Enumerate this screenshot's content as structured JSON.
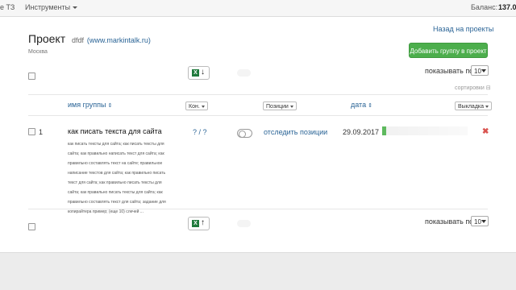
{
  "topbar": {
    "nav_tz": "е ТЗ",
    "nav_tools": "Инструменты",
    "balance_label": "Баланс:",
    "balance_value": "137.0"
  },
  "project": {
    "title": "Проект",
    "subtitle": "dfdf",
    "site": "(www.markintalk.ru)",
    "city": "Москва"
  },
  "actions": {
    "back": "Назад на проекты",
    "add_group": "Добавить группу в проект"
  },
  "pagination": {
    "show_label": "показывать по",
    "per_page": "10"
  },
  "sort_label": "сортировки",
  "columns": {
    "group_name": "имя группы",
    "competitors": "Кон.",
    "positions": "Позиции",
    "date": "дата",
    "unload": "Выкладка"
  },
  "rows": [
    {
      "num": "1",
      "name": "как писать текста для сайта",
      "keywords": "как писать тексты для сайта; как писать тексты для сайта; как правильно написать текст для сайта; как правильно составлять текст на сайте; правильное написание текстов для сайта; как правильно писать текст для сайта; как правильно писать тексты для сайта; как правильно писать тексты для сайта; как правильно составлять текст для сайта; задание для копирайтера пример; (еще 10) слечей ...",
      "ratio": "? / ?",
      "track": "отследить позиции",
      "date": "29.09.2017",
      "progress": 0.05
    }
  ],
  "colors": {
    "accent_link": "#2a6496",
    "success": "#5cb85c",
    "danger": "#d9534f"
  },
  "icons": {
    "excel_down": "excel-download-icon",
    "excel_up": "excel-upload-icon",
    "delete": "delete-icon"
  }
}
